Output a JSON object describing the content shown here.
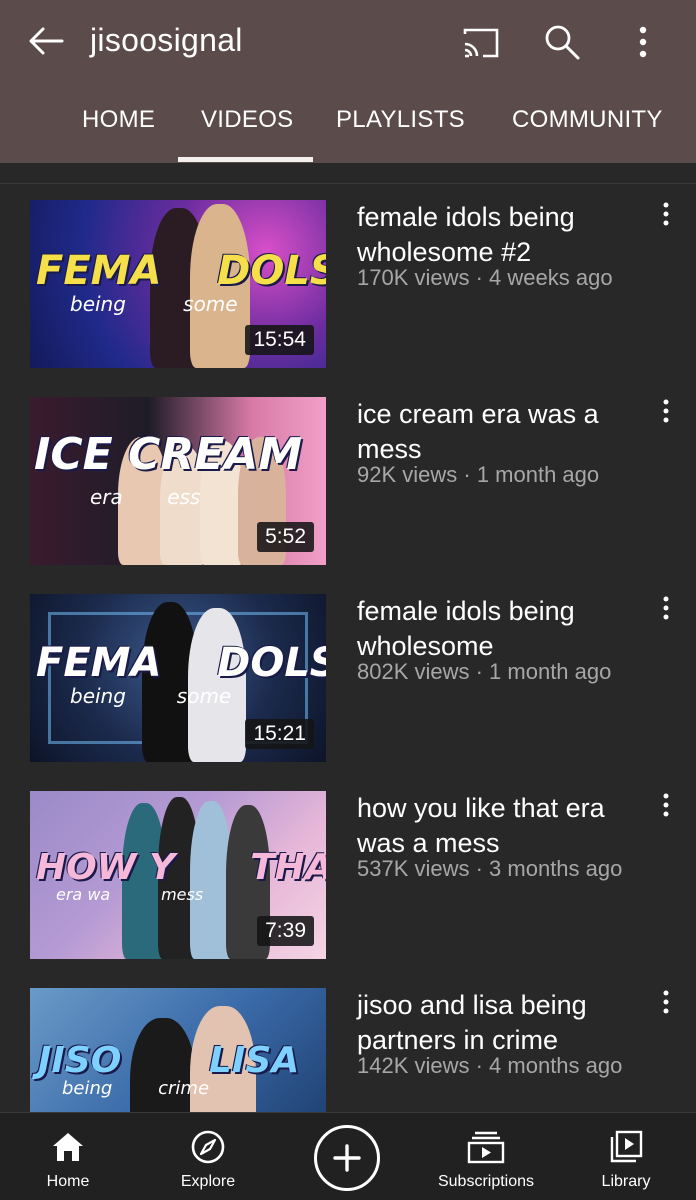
{
  "header": {
    "channel_name": "jisoosignal",
    "icons": [
      "back-arrow-icon",
      "cast-icon",
      "search-icon",
      "more-vert-icon"
    ]
  },
  "tabs": [
    {
      "label": "HOME"
    },
    {
      "label": "VIDEOS",
      "selected": true
    },
    {
      "label": "PLAYLISTS"
    },
    {
      "label": "COMMUNITY"
    }
  ],
  "videos": [
    {
      "title": "female idols being wholesome #2",
      "meta": "170K views · 4 weeks ago",
      "duration": "15:54",
      "thumb_text": "FEMA    DOLS",
      "thumb_sub": "being         some"
    },
    {
      "title": "ice cream era was a mess",
      "meta": "92K views · 1 month ago",
      "duration": "5:52",
      "thumb_text": "ICE CREAM",
      "thumb_sub": "era       ess"
    },
    {
      "title": "female idols being wholesome",
      "meta": "802K views · 1 month ago",
      "duration": "15:21",
      "thumb_text": "FEMA    DOLS",
      "thumb_sub": "being        some"
    },
    {
      "title": "how you like that era was a mess",
      "meta": "537K views · 3 months ago",
      "duration": "7:39",
      "thumb_text": "HOW Y      THAT",
      "thumb_sub": "era wa          mess"
    },
    {
      "title": "jisoo and lisa being partners in crime",
      "meta": "142K views · 4 months ago",
      "duration": "",
      "thumb_text": "JISO       LISA",
      "thumb_sub": "being        crime"
    }
  ],
  "bottom_nav": [
    {
      "label": "Home",
      "icon": "home-icon",
      "selected": true
    },
    {
      "label": "Explore",
      "icon": "compass-icon"
    },
    {
      "label": "",
      "icon": "create-plus-icon"
    },
    {
      "label": "Subscriptions",
      "icon": "subscriptions-icon"
    },
    {
      "label": "Library",
      "icon": "library-icon"
    }
  ],
  "colors": {
    "header_bg": "#5b4b4b",
    "page_bg": "#282828",
    "meta_text": "#a7a7a7",
    "nav_bg": "#212121"
  }
}
